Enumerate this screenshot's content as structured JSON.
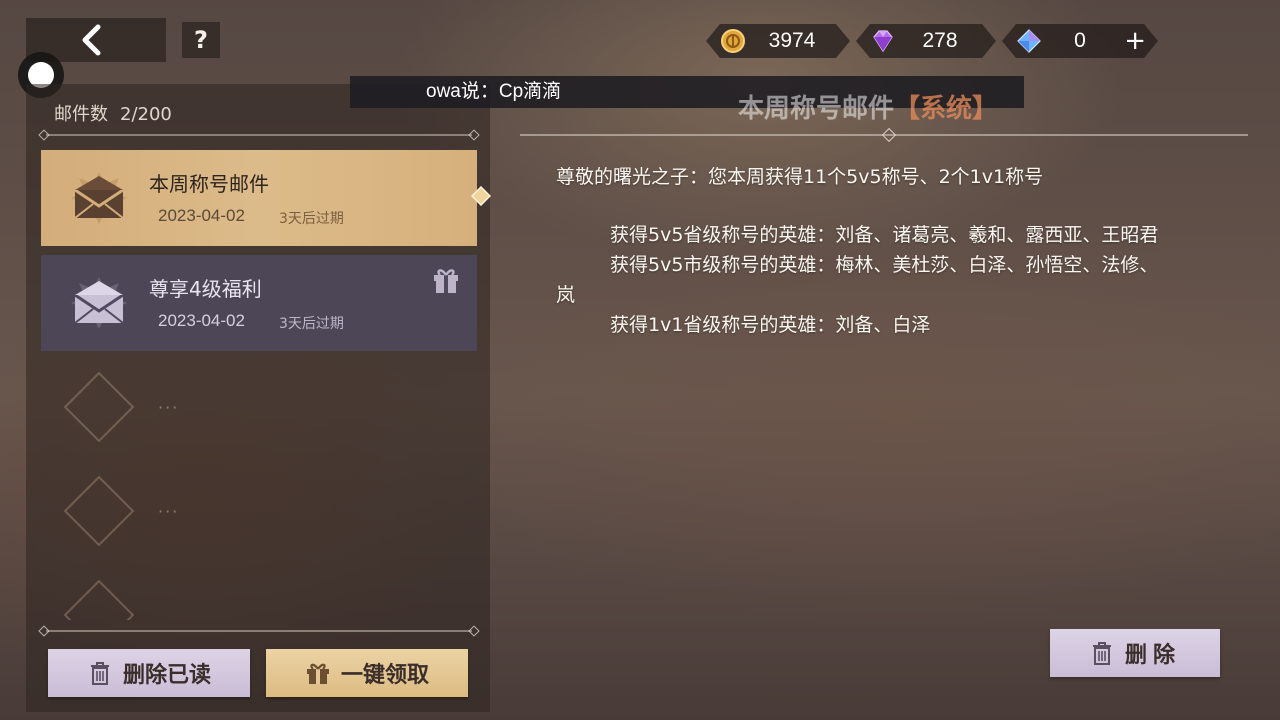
{
  "top_bar": {
    "help_label": "?",
    "currencies": [
      {
        "name": "gold-coin",
        "value": "3974"
      },
      {
        "name": "purple-diamond",
        "value": "278"
      },
      {
        "name": "blue-diamond",
        "value": "0"
      }
    ],
    "plus_label": "+"
  },
  "broadcast": {
    "text": "owa说：Cp滴滴"
  },
  "sidebar": {
    "count_label": "邮件数",
    "count_value": "2/200",
    "mails": [
      {
        "subject": "本周称号邮件",
        "date": "2023-04-02",
        "expire": "3天后过期",
        "selected": true
      },
      {
        "subject": "尊享4级福利",
        "date": "2023-04-02",
        "expire": "3天后过期",
        "selected": false,
        "has_gift": true
      }
    ],
    "empty_placeholder": "···",
    "delete_read_label": "删除已读",
    "claim_all_label": "一键领取"
  },
  "mail_detail": {
    "title": "本周称号邮件",
    "tag": "【系统】",
    "greeting": "尊敬的曙光之子：您本周获得11个5v5称号、2个1v1称号",
    "lines": [
      "获得5v5省级称号的英雄：刘备、诸葛亮、羲和、露西亚、王昭君",
      "获得5v5市级称号的英雄：梅林、美杜莎、白泽、孙悟空、法修、",
      "岚",
      "获得1v1省级称号的英雄：刘备、白泽"
    ],
    "delete_label": "删除"
  },
  "colors": {
    "selected_mail": "#d6b07c",
    "normal_mail": "#504a60",
    "tag": "#e88c5a",
    "button_lavender": "#d6cbe0",
    "button_gold": "#e6c896"
  }
}
